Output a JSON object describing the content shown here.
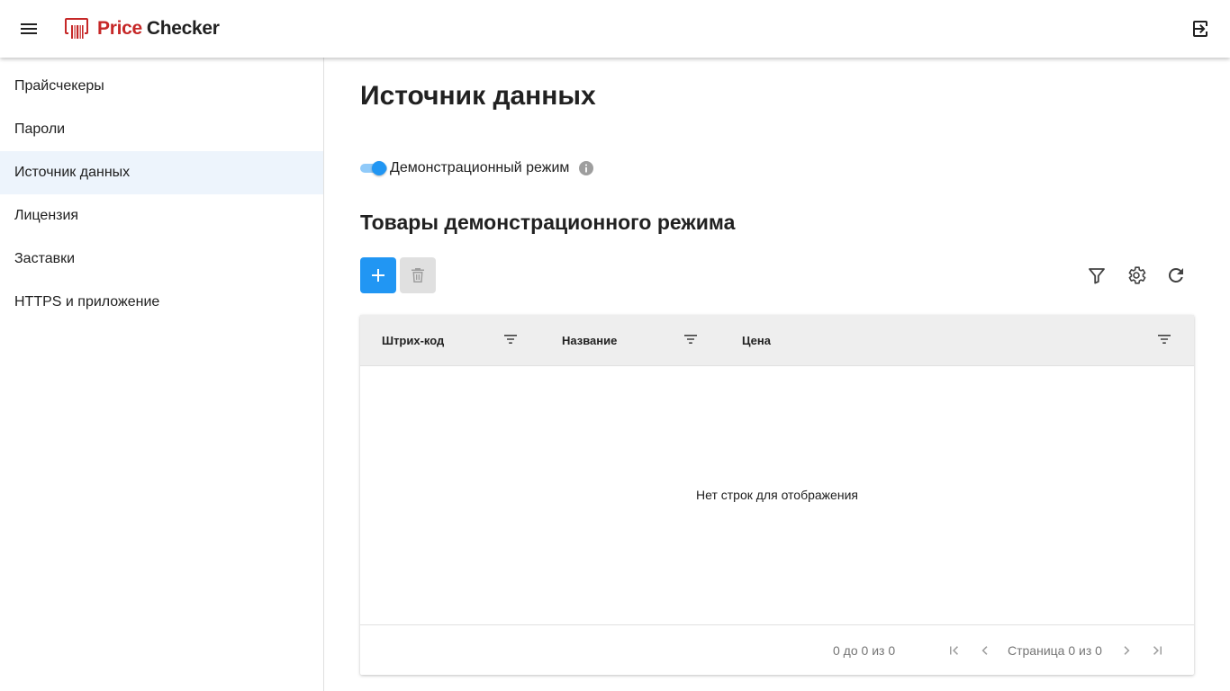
{
  "appbar": {
    "brand_price": "Price",
    "brand_checker": "Checker",
    "menu_icon": "hamburger-menu-icon",
    "logout_icon": "logout-icon"
  },
  "sidebar": {
    "items": [
      {
        "label": "Прайсчекеры",
        "active": false
      },
      {
        "label": "Пароли",
        "active": false
      },
      {
        "label": "Источник данных",
        "active": true
      },
      {
        "label": "Лицензия",
        "active": false
      },
      {
        "label": "Заставки",
        "active": false
      },
      {
        "label": "HTTPS и приложение",
        "active": false
      }
    ]
  },
  "main": {
    "title": "Источник данных",
    "demo_mode": {
      "label": "Демонстрационный режим",
      "enabled": true
    },
    "section_title": "Товары демонстрационного режима",
    "toolbar": {
      "add_icon": "plus-icon",
      "delete_icon": "trash-icon",
      "filter_icon": "filter-icon",
      "settings_icon": "gear-icon",
      "refresh_icon": "refresh-icon"
    },
    "grid": {
      "columns": [
        "Штрих-код",
        "Название",
        "Цена"
      ],
      "empty_message": "Нет строк для отображения",
      "range_text": "0 до 0 из 0",
      "page_text": "Страница 0 из 0"
    }
  },
  "colors": {
    "brand_red": "#c62828",
    "accent_blue": "#2196f3",
    "active_nav_bg": "#edf4fc"
  }
}
